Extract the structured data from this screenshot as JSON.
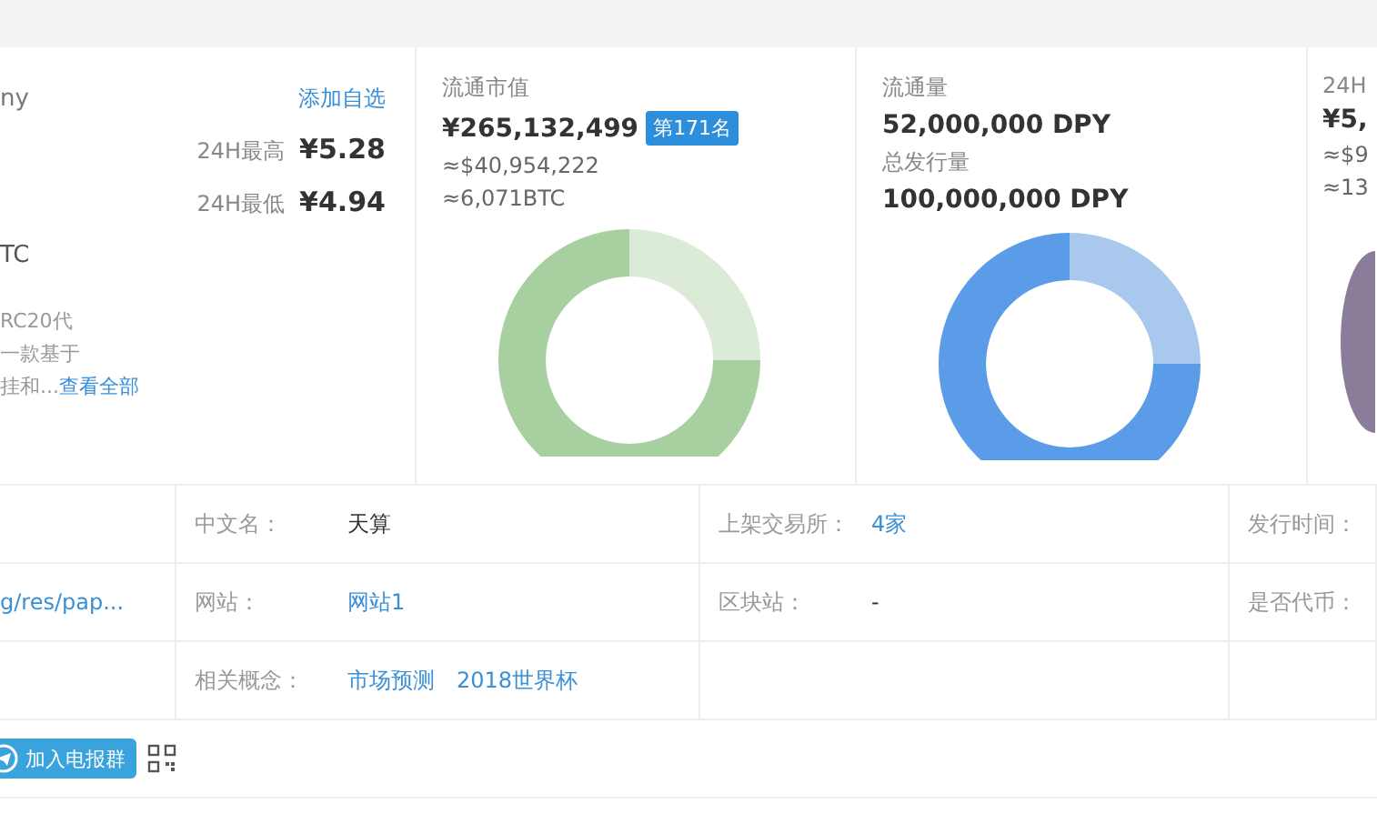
{
  "coin_panel": {
    "name_fragment": "ny",
    "watch_link": "添加自选",
    "prices": [
      {
        "label": "24H最高",
        "value": "¥5.28"
      },
      {
        "label": "24H最低",
        "value": "¥4.94"
      }
    ],
    "btc_fragment": "TC"
  },
  "stats": [
    {
      "lines": [
        {
          "kind": "label",
          "text": "流通市值"
        },
        {
          "kind": "value",
          "text": "¥265,132,499",
          "badge": "第171名"
        },
        {
          "kind": "sub",
          "text": "≈$40,954,222"
        },
        {
          "kind": "sub",
          "text": "≈6,071BTC"
        }
      ]
    },
    {
      "lines": [
        {
          "kind": "label",
          "text": "流通量"
        },
        {
          "kind": "value",
          "text": "52,000,000 DPY"
        },
        {
          "kind": "label",
          "text": "总发行量"
        },
        {
          "kind": "value",
          "text": "100,000,000 DPY"
        }
      ]
    },
    {
      "lines": [
        {
          "kind": "label",
          "text": "24H"
        },
        {
          "kind": "value",
          "text": "¥5,"
        },
        {
          "kind": "sub",
          "text": "≈$9"
        },
        {
          "kind": "sub",
          "text": "≈13"
        }
      ]
    }
  ],
  "description": {
    "lines": [
      "RC20代",
      "一款基于"
    ],
    "last_line": "挂和...",
    "more_link": "查看全部"
  },
  "details": [
    {
      "fields": [
        {
          "label": "中文名：",
          "values": [
            {
              "text": "天算",
              "link": false
            }
          ]
        },
        {
          "label": "上架交易所：",
          "values": [
            {
              "text": "4家",
              "link": true
            }
          ]
        },
        {
          "label": "发行时间："
        }
      ]
    },
    {
      "left": "g/res/pap...",
      "fields": [
        {
          "label": "网站：",
          "values": [
            {
              "text": "网站1",
              "link": true
            }
          ]
        },
        {
          "label": "区块站：",
          "values": [
            {
              "text": "-",
              "link": false
            }
          ]
        },
        {
          "label": "是否代币："
        }
      ]
    },
    {
      "fields": [
        {
          "label": "相关概念：",
          "values": [
            {
              "text": "市场预测",
              "link": true
            },
            {
              "text": "2018世界杯",
              "link": true
            }
          ]
        }
      ]
    }
  ],
  "telegram_button": "加入电报群"
}
